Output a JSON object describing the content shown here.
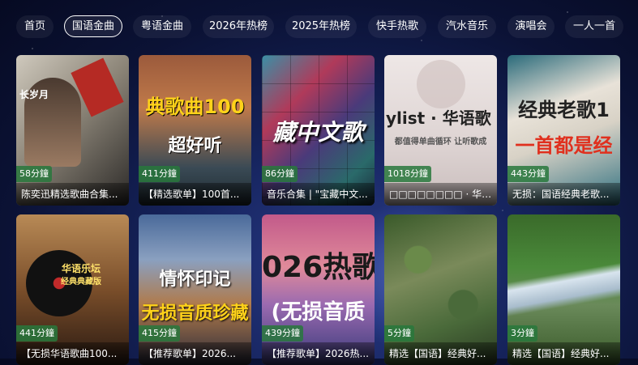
{
  "tabs": [
    {
      "label": "首页",
      "active": false
    },
    {
      "label": "国语金曲",
      "active": true
    },
    {
      "label": "粤语金曲",
      "active": false
    },
    {
      "label": "2026年热榜",
      "active": false
    },
    {
      "label": "2025年热榜",
      "active": false
    },
    {
      "label": "快手热歌",
      "active": false
    },
    {
      "label": "汽水音乐",
      "active": false
    },
    {
      "label": "演唱会",
      "active": false
    },
    {
      "label": "一人一首",
      "active": false
    }
  ],
  "cards": [
    {
      "duration": "58分鐘",
      "title": "陈奕迅精选歌曲合集...",
      "art": "长岁月"
    },
    {
      "duration": "411分鐘",
      "title": "【精选歌单】100首...",
      "art": "典歌曲100",
      "art2": "超好听"
    },
    {
      "duration": "86分鐘",
      "title": "音乐合集 | \"宝藏中文...",
      "art": "藏中文歌"
    },
    {
      "duration": "1018分鐘",
      "title": "□□□□□□□□ · 华语歌单...",
      "art": "ylist · 华语歌",
      "art2": "都值得单曲循环 让听歌成"
    },
    {
      "duration": "443分鐘",
      "title": "无损：国语经典老歌...",
      "art": "经典老歌1",
      "art2": "一首都是经"
    },
    {
      "duration": "441分鐘",
      "title": "【无损华语歌曲100...",
      "art": "华语乐坛",
      "art2": "经典典藏版"
    },
    {
      "duration": "415分鐘",
      "title": "【推荐歌单】2026...",
      "art": "情怀印记",
      "art2": "无损音质珍藏"
    },
    {
      "duration": "439分鐘",
      "title": "【推荐歌单】2026热...",
      "art": "026热歌",
      "art2": "(无损音质"
    },
    {
      "duration": "5分鐘",
      "title": "精选【国语】经典好...",
      "art": ""
    },
    {
      "duration": "3分鐘",
      "title": "精选【国语】经典好...",
      "art": ""
    }
  ]
}
